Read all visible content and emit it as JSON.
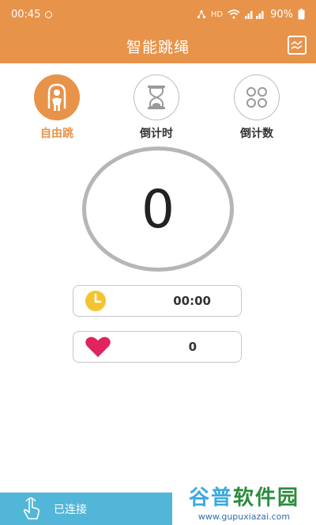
{
  "status_bar": {
    "time": "00:45",
    "network": "HD",
    "battery": "90%"
  },
  "header": {
    "title": "智能跳绳"
  },
  "modes": [
    {
      "label": "自由跳",
      "active": true
    },
    {
      "label": "倒计时",
      "active": false
    },
    {
      "label": "倒计数",
      "active": false
    }
  ],
  "counter": {
    "value": "0"
  },
  "stats": {
    "time_value": "00:00",
    "heart_value": "0"
  },
  "connection": {
    "status": "已连接"
  },
  "watermark": {
    "title_part1": "谷普",
    "title_part2": "软件园",
    "url": "www.gupuxiazai.com"
  },
  "colors": {
    "accent": "#e8934a",
    "bottom_bar": "#52b6d9",
    "clock": "#f4c430",
    "heart": "#e0245e"
  }
}
